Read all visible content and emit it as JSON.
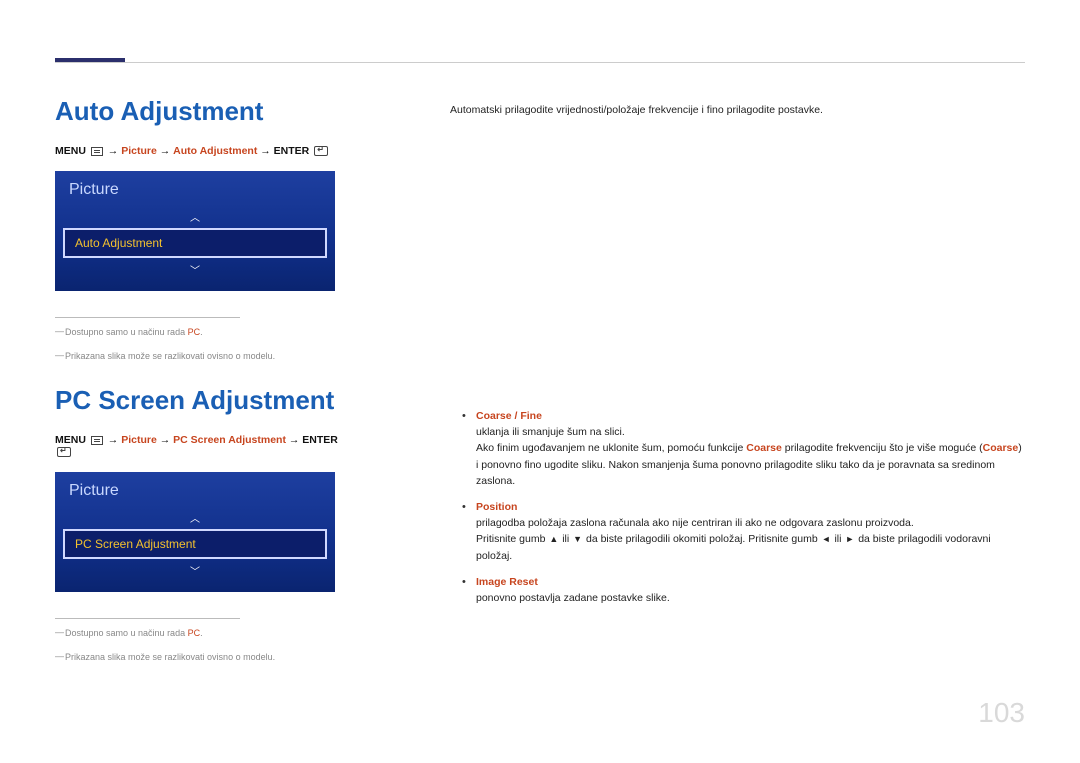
{
  "page_number": "103",
  "section1": {
    "title": "Auto Adjustment",
    "path": {
      "menu": "MENU",
      "p1": "Picture",
      "p2": "Auto Adjustment",
      "enter": "ENTER"
    },
    "osd": {
      "title": "Picture",
      "item": "Auto Adjustment"
    },
    "note1_prefix": "Dostupno samo u načinu rada ",
    "note1_accent": "PC",
    "note1_suffix": ".",
    "note2": "Prikazana slika može se razlikovati ovisno o modelu.",
    "description": "Automatski prilagodite vrijednosti/položaje frekvencije i fino prilagodite postavke."
  },
  "section2": {
    "title": "PC Screen Adjustment",
    "path": {
      "menu": "MENU",
      "p1": "Picture",
      "p2": "PC Screen Adjustment",
      "enter": "ENTER"
    },
    "osd": {
      "title": "Picture",
      "item": "PC Screen Adjustment"
    },
    "note1_prefix": "Dostupno samo u načinu rada ",
    "note1_accent": "PC",
    "note1_suffix": ".",
    "note2": "Prikazana slika može se razlikovati ovisno o modelu.",
    "bullets": [
      {
        "title": "Coarse / Fine",
        "text1": "uklanja ili smanjuje šum na slici.",
        "text2_a": "Ako finim ugođavanjem ne uklonite šum, pomoću funkcije ",
        "text2_b": "Coarse",
        "text2_c": " prilagodite frekvenciju što je više moguće (",
        "text2_d": "Coarse",
        "text2_e": ") i ponovno fino ugodite sliku. Nakon smanjenja šuma ponovno prilagodite sliku tako da je poravnata sa sredinom zaslona."
      },
      {
        "title": "Position",
        "text1": "prilagodba položaja zaslona računala ako nije centriran ili ako ne odgovara zaslonu proizvoda.",
        "text2_a": "Pritisnite gumb ",
        "text2_b": " ili ",
        "text2_c": " da biste prilagodili okomiti položaj. Pritisnite gumb ",
        "text2_d": " ili ",
        "text2_e": " da biste prilagodili vodoravni položaj."
      },
      {
        "title": "Image Reset",
        "text1": "ponovno postavlja zadane postavke slike."
      }
    ]
  }
}
